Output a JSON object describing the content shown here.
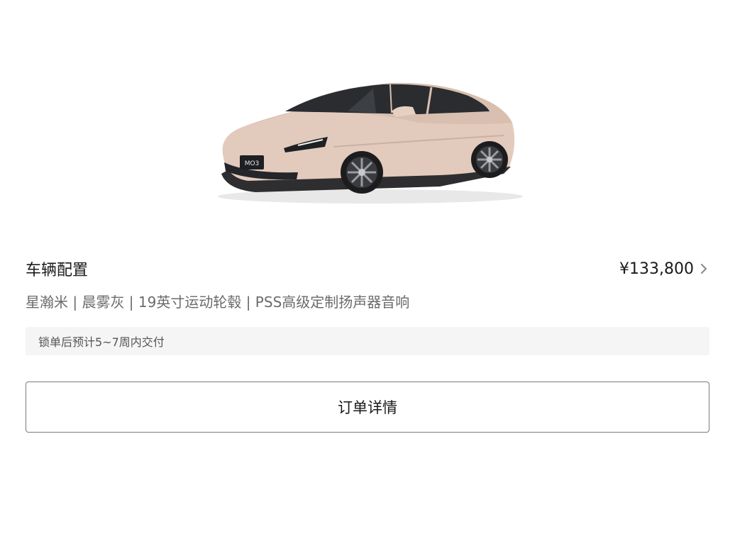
{
  "top_fragment": "· · · ·",
  "car": {
    "plate_text": "MO3"
  },
  "config": {
    "title": "车辆配置",
    "price": "¥133,800"
  },
  "specs": "星瀚米 | 晨雾灰 | 19英寸运动轮毂 | PSS高级定制扬声器音响",
  "delivery_note": "锁单后预计5~7周内交付",
  "order_button_label": "订单详情"
}
